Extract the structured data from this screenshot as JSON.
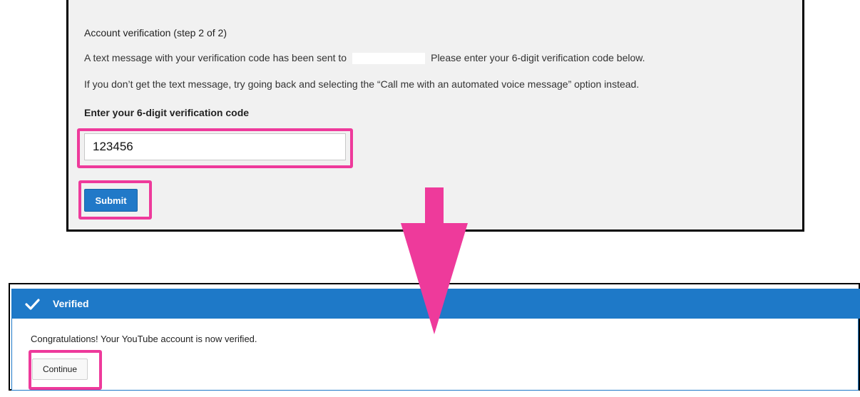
{
  "verification_step": {
    "title": "Account verification (step 2 of 2)",
    "line1_before": "A text message with your verification code has been sent to",
    "line1_after": "Please enter your 6-digit verification code below.",
    "line2": "If you don’t get the text message, try going back and selecting the “Call me with an automated voice message” option instead.",
    "code_label": "Enter your 6-digit verification code",
    "code_value": "123456",
    "submit_label": "Submit"
  },
  "verified": {
    "title": "Verified",
    "message": "Congratulations! Your YouTube account is now verified.",
    "continue_label": "Continue"
  },
  "colors": {
    "highlight": "#ee3a9b",
    "accent_blue": "#1e79c8",
    "panel_bg": "#f1f1f1"
  },
  "icons": {
    "verified": "checkmark-icon",
    "flow": "down-arrow-icon"
  }
}
